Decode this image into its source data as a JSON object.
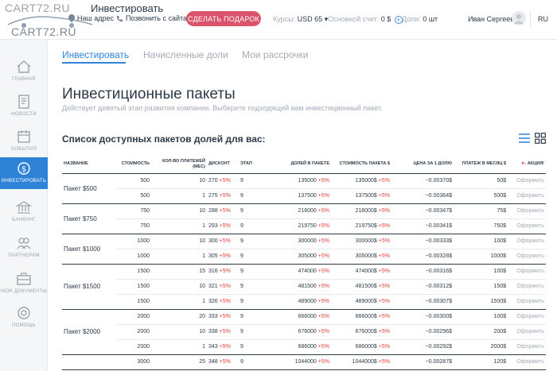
{
  "header": {
    "logo_top": "CART72.RU",
    "logo_bottom": "CART72.RU",
    "page_head": "Инвестировать",
    "address_label": "Наш адрес",
    "call_label": "Позвонить с сайта",
    "gift_button": "СДЕЛАТЬ ПОДАРОК",
    "rate_label": "Курсы:",
    "rate_value": "USD 65",
    "balance_label": "Основной счет:",
    "balance_value": "0 $",
    "shares_label": "Доли:",
    "shares_value": "0 шт",
    "user_name": "Иван Сергеев",
    "lang": "RU"
  },
  "sidebar": {
    "items": [
      {
        "label": "ГЛАВНАЯ"
      },
      {
        "label": "НОВОСТИ"
      },
      {
        "label": "СОБЫТИЯ"
      },
      {
        "label": "ИНВЕСТИРОВАТЬ"
      },
      {
        "label": "БАНКИНГ"
      },
      {
        "label": "ПАРТНЕРАМ"
      },
      {
        "label": "МОИ ДОКУМЕНТЫ"
      },
      {
        "label": "ПОМОЩЬ"
      }
    ]
  },
  "tabs": [
    {
      "label": "Инвестировать"
    },
    {
      "label": "Начисленные доли"
    },
    {
      "label": "Мои рассрочки"
    }
  ],
  "main": {
    "title": "Инвестиционные пакеты",
    "subtitle": "Действует девятый этап развития компании. Выберите подходящий вам инвестиционный пакет.",
    "list_title": "Список доступных пакетов долей для вас:"
  },
  "table": {
    "columns": [
      "НАЗВАНИЕ",
      "СТОИМОСТЬ",
      "КОЛ-ВО ПЛАТЕЖЕЙ (МЕС)",
      "ДИСКОНТ",
      "ЭТАП",
      "ДОЛЕЙ В ПАКЕТЕ",
      "СТОИМОСТЬ ПАКЕТА $",
      "ЦЕНА ЗА 1 ДОЛЮ",
      "ПЛАТЕЖ В МЕСЯЦ $",
      "- Акция!"
    ],
    "pct": "+5%",
    "action": "Оформить",
    "packages": [
      {
        "name": "Пакет $500",
        "rows": [
          {
            "cost": "500",
            "payments": "10",
            "discount": "270",
            "stage": "9",
            "shares": "135000",
            "pkg_cost": "135000$",
            "price": "~0.00370$",
            "monthly": "50$"
          },
          {
            "cost": "500",
            "payments": "1",
            "discount": "275",
            "stage": "9",
            "shares": "137500",
            "pkg_cost": "137500$",
            "price": "~0.00364$",
            "monthly": "500$"
          }
        ]
      },
      {
        "name": "Пакет $750",
        "rows": [
          {
            "cost": "750",
            "payments": "10",
            "discount": "288",
            "stage": "9",
            "shares": "216000",
            "pkg_cost": "216000$",
            "price": "~0.00347$",
            "monthly": "75$"
          },
          {
            "cost": "750",
            "payments": "1",
            "discount": "293",
            "stage": "9",
            "shares": "219750",
            "pkg_cost": "219750$",
            "price": "~0.00341$",
            "monthly": "750$"
          }
        ]
      },
      {
        "name": "Пакет $1000",
        "rows": [
          {
            "cost": "1000",
            "payments": "10",
            "discount": "300",
            "stage": "9",
            "shares": "300000",
            "pkg_cost": "300000$",
            "price": "~0.00333$",
            "monthly": "100$"
          },
          {
            "cost": "1000",
            "payments": "1",
            "discount": "305",
            "stage": "9",
            "shares": "305000",
            "pkg_cost": "305000$",
            "price": "~0.00328$",
            "monthly": "1000$"
          }
        ]
      },
      {
        "name": "Пакет $1500",
        "rows": [
          {
            "cost": "1500",
            "payments": "15",
            "discount": "316",
            "stage": "9",
            "shares": "474000",
            "pkg_cost": "474000$",
            "price": "~0.00316$",
            "monthly": "100$"
          },
          {
            "cost": "1500",
            "payments": "10",
            "discount": "321",
            "stage": "9",
            "shares": "481500",
            "pkg_cost": "481500$",
            "price": "~0.00312$",
            "monthly": "150$"
          },
          {
            "cost": "1500",
            "payments": "1",
            "discount": "326",
            "stage": "9",
            "shares": "489000",
            "pkg_cost": "489000$",
            "price": "~0.00307$",
            "monthly": "1500$"
          }
        ]
      },
      {
        "name": "Пакет $2000",
        "rows": [
          {
            "cost": "2000",
            "payments": "20",
            "discount": "333",
            "stage": "9",
            "shares": "666000",
            "pkg_cost": "666000$",
            "price": "~0.00300$",
            "monthly": "100$"
          },
          {
            "cost": "2000",
            "payments": "10",
            "discount": "338",
            "stage": "9",
            "shares": "676000",
            "pkg_cost": "676000$",
            "price": "~0.00296$",
            "monthly": "200$"
          },
          {
            "cost": "2000",
            "payments": "1",
            "discount": "343",
            "stage": "9",
            "shares": "686000",
            "pkg_cost": "686000$",
            "price": "~0.00292$",
            "monthly": "2000$"
          }
        ]
      },
      {
        "name": "",
        "rows": [
          {
            "cost": "3000",
            "payments": "25",
            "discount": "348",
            "stage": "9",
            "shares": "1044000",
            "pkg_cost": "1044000$",
            "price": "~0.00287$",
            "monthly": "120$"
          }
        ]
      }
    ]
  },
  "colors": {
    "accent": "#2f83d6",
    "gift": "#d9546b",
    "percent": "#e23d3d"
  }
}
